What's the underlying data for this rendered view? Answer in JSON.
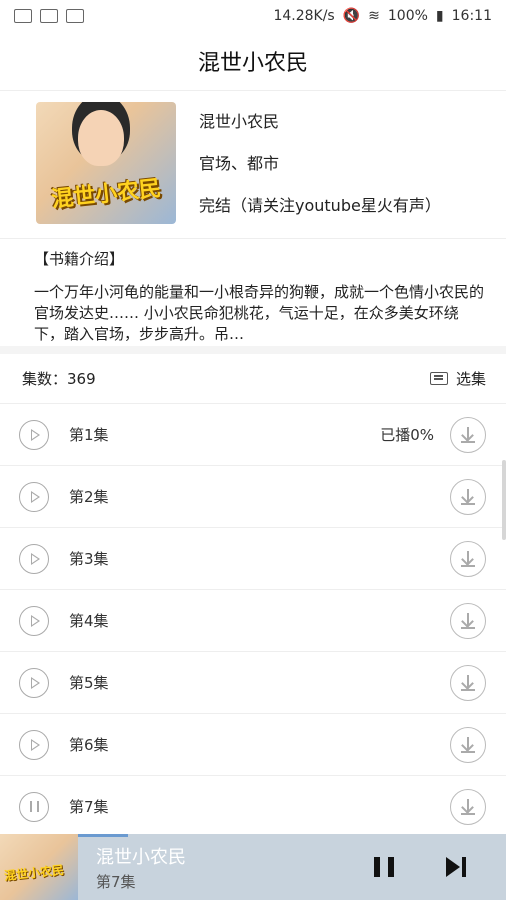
{
  "status_bar": {
    "speed": "14.28K/s",
    "battery": "100%",
    "time": "16:11"
  },
  "header": {
    "title": "混世小农民"
  },
  "book": {
    "cover_text": "混世小农民",
    "title": "混世小农民",
    "category": "官场、都市",
    "status": "完结（请关注youtube星火有声）"
  },
  "intro": {
    "heading": "【书籍介绍】",
    "text": "一个万年小河龟的能量和一小根奇异的狗鞭，成就一个色情小农民的官场发达史…… 小小农民命犯桃花，气运十足，在众多美女环绕下，踏入官场，步步高升。吊…"
  },
  "list": {
    "count_label": "集数：369",
    "select_label": "选集"
  },
  "episodes": [
    {
      "label": "第1集",
      "progress": "已播0%",
      "state": "play"
    },
    {
      "label": "第2集",
      "progress": "",
      "state": "play"
    },
    {
      "label": "第3集",
      "progress": "",
      "state": "play"
    },
    {
      "label": "第4集",
      "progress": "",
      "state": "play"
    },
    {
      "label": "第5集",
      "progress": "",
      "state": "play"
    },
    {
      "label": "第6集",
      "progress": "",
      "state": "play"
    },
    {
      "label": "第7集",
      "progress": "",
      "state": "pause"
    }
  ],
  "player": {
    "cover_text": "混世小农民",
    "title": "混世小农民",
    "episode": "第7集"
  },
  "colors": {
    "player_bg": "#c8d3dd",
    "accent": "#6a9ad0"
  },
  "icons": [
    "play-icon",
    "pause-icon",
    "download-icon",
    "list-icon",
    "next-icon"
  ]
}
